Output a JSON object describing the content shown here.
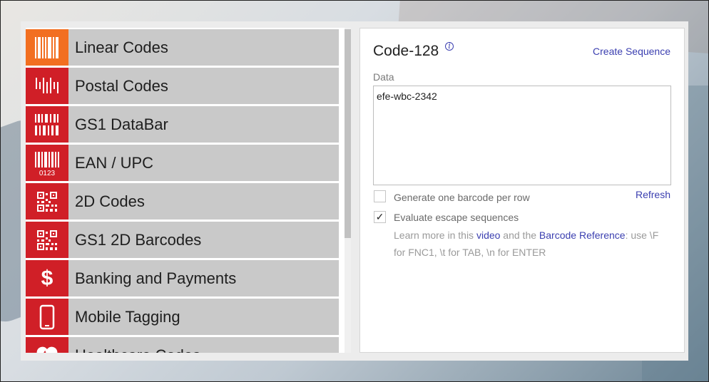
{
  "menu": {
    "items": [
      {
        "label": "Linear Codes",
        "icon": "linear-barcode-icon",
        "active": true
      },
      {
        "label": "Postal Codes",
        "icon": "postal-barcode-icon",
        "active": false
      },
      {
        "label": "GS1 DataBar",
        "icon": "databar-icon",
        "active": false
      },
      {
        "label": "EAN / UPC",
        "icon": "ean-upc-icon",
        "active": false
      },
      {
        "label": "2D Codes",
        "icon": "qr-code-icon",
        "active": false
      },
      {
        "label": "GS1 2D Barcodes",
        "icon": "qr-code-icon",
        "active": false
      },
      {
        "label": "Banking and Payments",
        "icon": "dollar-icon",
        "active": false
      },
      {
        "label": "Mobile Tagging",
        "icon": "phone-icon",
        "active": false
      },
      {
        "label": "Healthcare Codes",
        "icon": "heart-icon",
        "active": false
      }
    ],
    "ean_digits": "0123",
    "dollar_glyph": "$"
  },
  "content": {
    "title": "Code-128",
    "info_glyph": "i",
    "create_sequence": "Create Sequence",
    "data_label": "Data",
    "data_value": "efe-wbc-2342",
    "refresh": "Refresh",
    "checkbox_one": {
      "label": "Generate one barcode per row",
      "checked": false
    },
    "checkbox_two": {
      "label": "Evaluate escape sequences",
      "checked": true,
      "mark": "✓"
    },
    "help": {
      "part1": "Learn more in this ",
      "link1": "video",
      "part2": " and the ",
      "link2": "Barcode Reference",
      "part3": ": use \\F for FNC1, \\t for TAB, \\n for ENTER"
    }
  },
  "colors": {
    "active_icon": "#f26f21",
    "icon_red": "#d01f27",
    "link": "#3b3fb0"
  }
}
